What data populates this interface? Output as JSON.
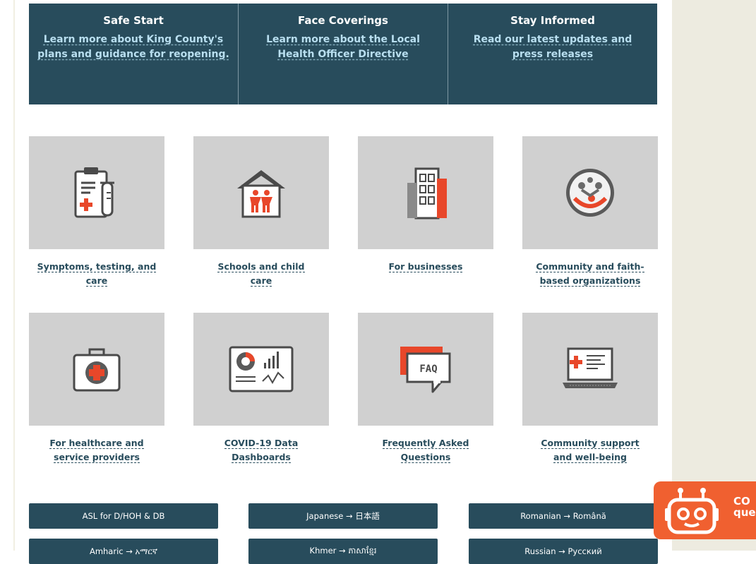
{
  "banner": [
    {
      "title": "Safe Start",
      "link": "Learn more about King County's plans and guidance for reopening."
    },
    {
      "title": "Face Coverings",
      "link": "Learn more about the Local Health Officer Directive"
    },
    {
      "title": "Stay Informed",
      "link": "Read our latest updates and press releases"
    }
  ],
  "tiles": [
    {
      "label": "Symptoms, testing, and care",
      "icon": "clipboard-icon"
    },
    {
      "label": "Schools and child care",
      "icon": "school-icon"
    },
    {
      "label": "For businesses",
      "icon": "building-icon"
    },
    {
      "label": "Community and faith-based organizations",
      "icon": "community-icon"
    },
    {
      "label": "For healthcare and service providers",
      "icon": "medical-kit-icon"
    },
    {
      "label": "COVID-19 Data Dashboards",
      "icon": "dashboard-icon"
    },
    {
      "label": "Frequently Asked Questions",
      "icon": "faq-icon",
      "icon_text": "FAQ"
    },
    {
      "label": "Community support and well-being",
      "icon": "laptop-icon"
    }
  ],
  "languages": [
    "ASL for D/HOH & DB",
    "Japanese → 日本語",
    "Romanian → Română",
    "Amharic → አማርኛ",
    "Khmer → ភាសាខ្មែរ",
    "Russian → Русский"
  ],
  "chatbot": {
    "line1": "CO",
    "line2": "que"
  },
  "colors": {
    "banner": "#284c5c",
    "link": "#b9dff0",
    "tile": "#d0d0d0",
    "accent": "#f06030"
  }
}
